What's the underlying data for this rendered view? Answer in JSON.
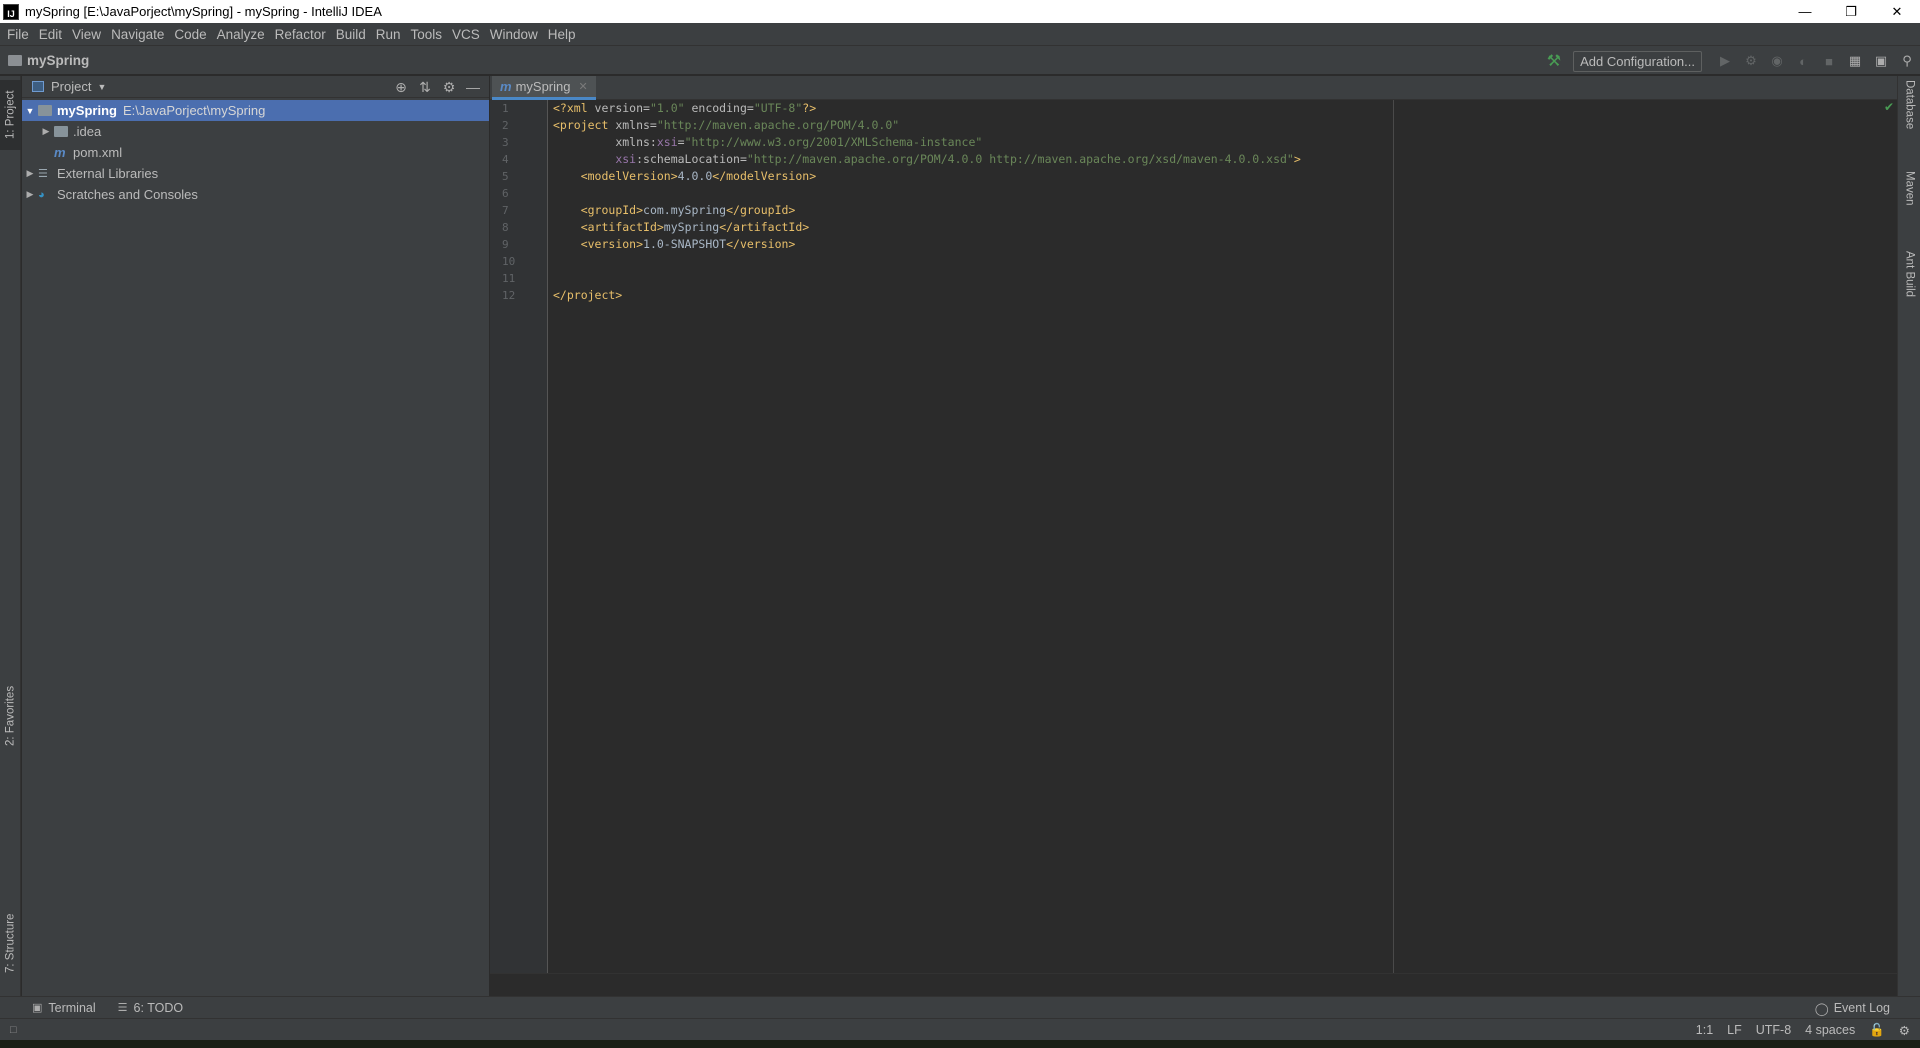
{
  "window": {
    "title": "mySpring [E:\\JavaPorject\\mySpring] - mySpring - IntelliJ IDEA",
    "app_icon_text": "IJ",
    "controls": [
      "—",
      "❐",
      "✕"
    ]
  },
  "menu": [
    "File",
    "Edit",
    "View",
    "Navigate",
    "Code",
    "Analyze",
    "Refactor",
    "Build",
    "Run",
    "Tools",
    "VCS",
    "Window",
    "Help"
  ],
  "navbar": {
    "project": "mySpring",
    "add_configuration": "Add Configuration...",
    "icons": [
      "hammer-icon",
      "run-icon",
      "debug-icon",
      "coverage-icon",
      "profile-icon",
      "stop-icon",
      "project-structure-icon",
      "frame-icon",
      "search-icon"
    ]
  },
  "left_tabs": {
    "project": "1: Project",
    "favorites": "2: Favorites",
    "structure": "7: Structure"
  },
  "right_tabs": {
    "database": "Database",
    "maven": "Maven",
    "ant": "Ant Build"
  },
  "project_panel": {
    "title": "Project",
    "tree": [
      {
        "name": "mySpring",
        "path": "E:\\JavaPorject\\mySpring"
      },
      {
        "name": ".idea"
      },
      {
        "name": "pom.xml"
      },
      {
        "name": "External Libraries"
      },
      {
        "name": "Scratches and Consoles"
      }
    ]
  },
  "editor": {
    "tab_label": "mySpring",
    "line_numbers": [
      "1",
      "2",
      "3",
      "4",
      "5",
      "6",
      "7",
      "8",
      "9",
      "10",
      "11",
      "12"
    ]
  },
  "bottom_tools": {
    "terminal": "Terminal",
    "todo": "6: TODO",
    "event_log": "Event Log"
  },
  "status": {
    "position": "1:1",
    "line_sep": "LF",
    "encoding": "UTF-8",
    "indent": "4 spaces"
  }
}
